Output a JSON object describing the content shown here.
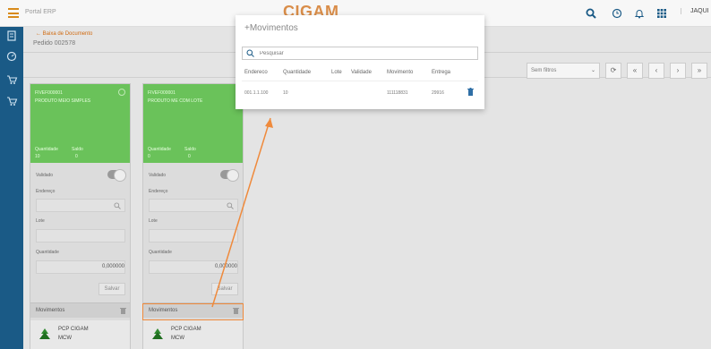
{
  "topbar": {
    "portal_title": "Portal ERP",
    "brand": "CIGAM",
    "user_label": "JAQUI"
  },
  "breadcrumb": {
    "back_label": "Baixa de Documento",
    "pedido": "Pedido 002578"
  },
  "toolbar": {
    "filter_value": "Sem filtros",
    "filter_chevron": "⌄"
  },
  "cards": [
    {
      "code": "FIVEF000001",
      "name": "PRODUTO MEIO SIMPLES",
      "qty_label": "Quantidade",
      "qty_value": "10",
      "saldo_label": "Saldo",
      "saldo_value": "0",
      "validado_label": "Validado",
      "endereco_label": "Endereço",
      "lote_label": "Lote",
      "quantidade_label": "Quantidade",
      "quantidade_value": "0,000000",
      "save_label": "Salvar",
      "mov_label": "Movimentos",
      "pcp_line1": "PCP CIGAM",
      "pcp_line2": "MCW"
    },
    {
      "code": "FIVEF000001",
      "name": "PRODUTO ME COM LOTE",
      "qty_label": "Quantidade",
      "qty_value": "0",
      "saldo_label": "Saldo",
      "saldo_value": "0",
      "validado_label": "Validado",
      "endereco_label": "Endereço",
      "lote_label": "Lote",
      "quantidade_label": "Quantidade",
      "quantidade_value": "0,000000",
      "save_label": "Salvar",
      "mov_label": "Movimentos",
      "pcp_line1": "PCP CIGAM",
      "pcp_line2": "MCW"
    }
  ],
  "modal": {
    "title": "Movimentos",
    "search_placeholder": "Pesquisar",
    "columns": [
      "Endereco",
      "Quantidade",
      "Lote",
      "Validade",
      "Movimento",
      "Entrega"
    ],
    "rows": [
      [
        "001.1.1.100",
        "10",
        "",
        "",
        "111118831",
        "29916"
      ]
    ]
  },
  "colors": {
    "accent": "#d06a10",
    "rail": "#1a5a86",
    "card_green": "#6ac25a",
    "highlight": "#ef8a3c"
  },
  "icons": [
    "menu-icon",
    "search-icon",
    "clock-icon",
    "bell-icon",
    "apps-icon",
    "trash-icon",
    "chevron-down-icon"
  ]
}
